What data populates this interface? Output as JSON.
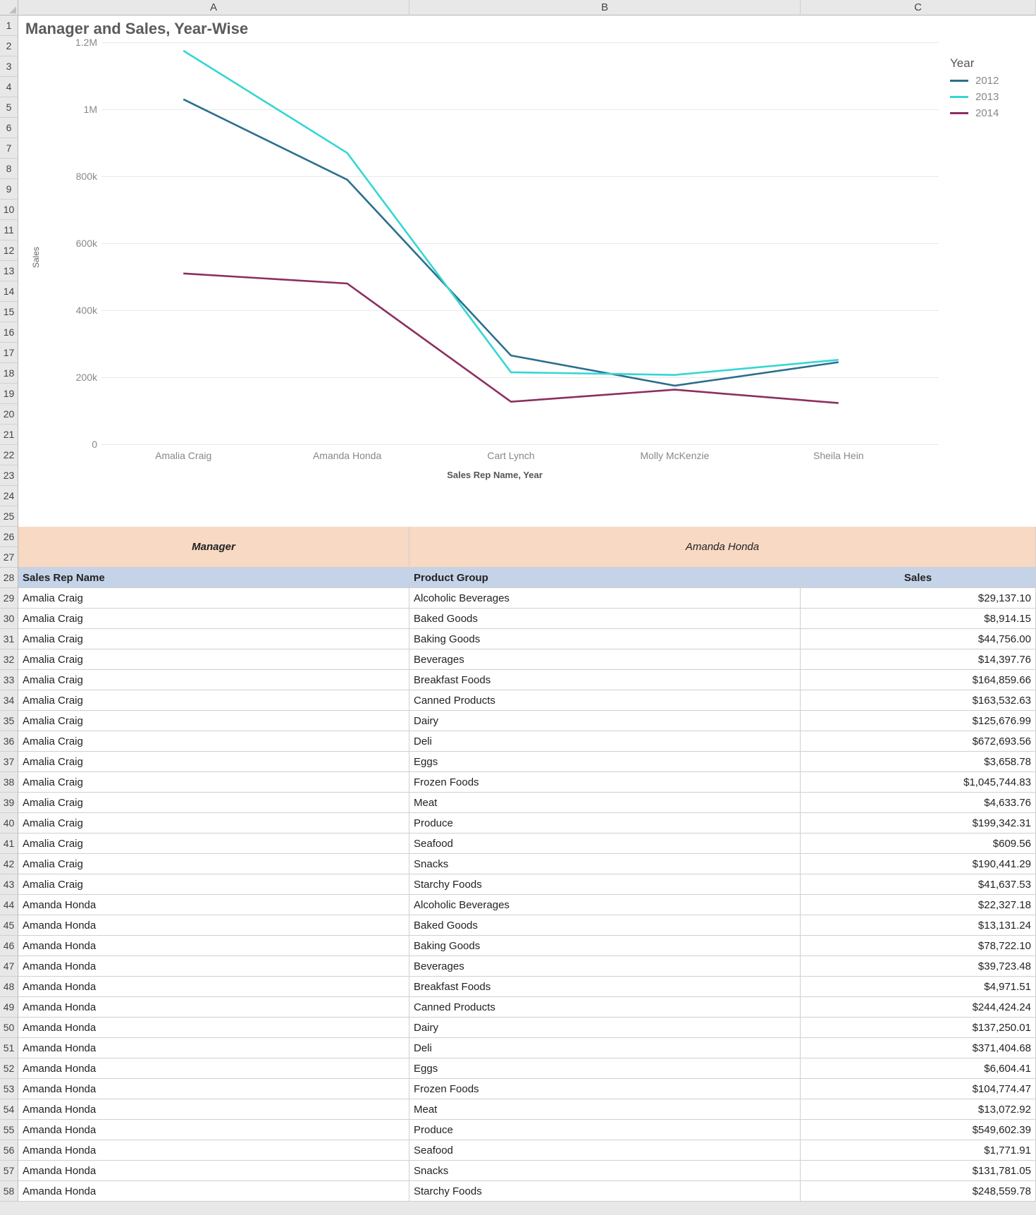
{
  "columns": [
    "A",
    "B",
    "C"
  ],
  "row_count": 58,
  "chart_data": {
    "type": "line",
    "title": "Manager and Sales, Year-Wise",
    "xlabel": "Sales Rep Name, Year",
    "ylabel": "Sales",
    "ylim": [
      0,
      1200000
    ],
    "y_ticks": [
      0,
      200000,
      400000,
      600000,
      800000,
      1000000,
      1200000
    ],
    "y_tick_labels": [
      "0",
      "200k",
      "400k",
      "600k",
      "800k",
      "1M",
      "1.2M"
    ],
    "categories": [
      "Amalia Craig",
      "Amanda Honda",
      "Cart Lynch",
      "Molly McKenzie",
      "Sheila Hein"
    ],
    "legend_title": "Year",
    "series": [
      {
        "name": "2012",
        "color": "#2c6e8e",
        "values": [
          1030000,
          790000,
          265000,
          175000,
          245000
        ]
      },
      {
        "name": "2013",
        "color": "#35d6d3",
        "values": [
          1175000,
          870000,
          215000,
          207000,
          252000
        ]
      },
      {
        "name": "2014",
        "color": "#8c2f5f",
        "values": [
          510000,
          480000,
          127000,
          163000,
          123000
        ]
      }
    ]
  },
  "manager_header": {
    "label": "Manager",
    "value": "Amanda Honda"
  },
  "table": {
    "headers": [
      "Sales Rep Name",
      "Product Group",
      "Sales"
    ],
    "rows": [
      {
        "rep": "Amalia Craig",
        "group": "Alcoholic Beverages",
        "sales": "$29,137.10"
      },
      {
        "rep": "Amalia Craig",
        "group": "Baked Goods",
        "sales": "$8,914.15"
      },
      {
        "rep": "Amalia Craig",
        "group": "Baking Goods",
        "sales": "$44,756.00"
      },
      {
        "rep": "Amalia Craig",
        "group": "Beverages",
        "sales": "$14,397.76"
      },
      {
        "rep": "Amalia Craig",
        "group": "Breakfast Foods",
        "sales": "$164,859.66"
      },
      {
        "rep": "Amalia Craig",
        "group": "Canned Products",
        "sales": "$163,532.63"
      },
      {
        "rep": "Amalia Craig",
        "group": "Dairy",
        "sales": "$125,676.99"
      },
      {
        "rep": "Amalia Craig",
        "group": "Deli",
        "sales": "$672,693.56"
      },
      {
        "rep": "Amalia Craig",
        "group": "Eggs",
        "sales": "$3,658.78"
      },
      {
        "rep": "Amalia Craig",
        "group": "Frozen Foods",
        "sales": "$1,045,744.83"
      },
      {
        "rep": "Amalia Craig",
        "group": "Meat",
        "sales": "$4,633.76"
      },
      {
        "rep": "Amalia Craig",
        "group": "Produce",
        "sales": "$199,342.31"
      },
      {
        "rep": "Amalia Craig",
        "group": "Seafood",
        "sales": "$609.56"
      },
      {
        "rep": "Amalia Craig",
        "group": "Snacks",
        "sales": "$190,441.29"
      },
      {
        "rep": "Amalia Craig",
        "group": "Starchy Foods",
        "sales": "$41,637.53"
      },
      {
        "rep": "Amanda Honda",
        "group": "Alcoholic Beverages",
        "sales": "$22,327.18"
      },
      {
        "rep": "Amanda Honda",
        "group": "Baked Goods",
        "sales": "$13,131.24"
      },
      {
        "rep": "Amanda Honda",
        "group": "Baking Goods",
        "sales": "$78,722.10"
      },
      {
        "rep": "Amanda Honda",
        "group": "Beverages",
        "sales": "$39,723.48"
      },
      {
        "rep": "Amanda Honda",
        "group": "Breakfast Foods",
        "sales": "$4,971.51"
      },
      {
        "rep": "Amanda Honda",
        "group": "Canned Products",
        "sales": "$244,424.24"
      },
      {
        "rep": "Amanda Honda",
        "group": "Dairy",
        "sales": "$137,250.01"
      },
      {
        "rep": "Amanda Honda",
        "group": "Deli",
        "sales": "$371,404.68"
      },
      {
        "rep": "Amanda Honda",
        "group": "Eggs",
        "sales": "$6,604.41"
      },
      {
        "rep": "Amanda Honda",
        "group": "Frozen Foods",
        "sales": "$104,774.47"
      },
      {
        "rep": "Amanda Honda",
        "group": "Meat",
        "sales": "$13,072.92"
      },
      {
        "rep": "Amanda Honda",
        "group": "Produce",
        "sales": "$549,602.39"
      },
      {
        "rep": "Amanda Honda",
        "group": "Seafood",
        "sales": "$1,771.91"
      },
      {
        "rep": "Amanda Honda",
        "group": "Snacks",
        "sales": "$131,781.05"
      },
      {
        "rep": "Amanda Honda",
        "group": "Starchy Foods",
        "sales": "$248,559.78"
      }
    ]
  }
}
